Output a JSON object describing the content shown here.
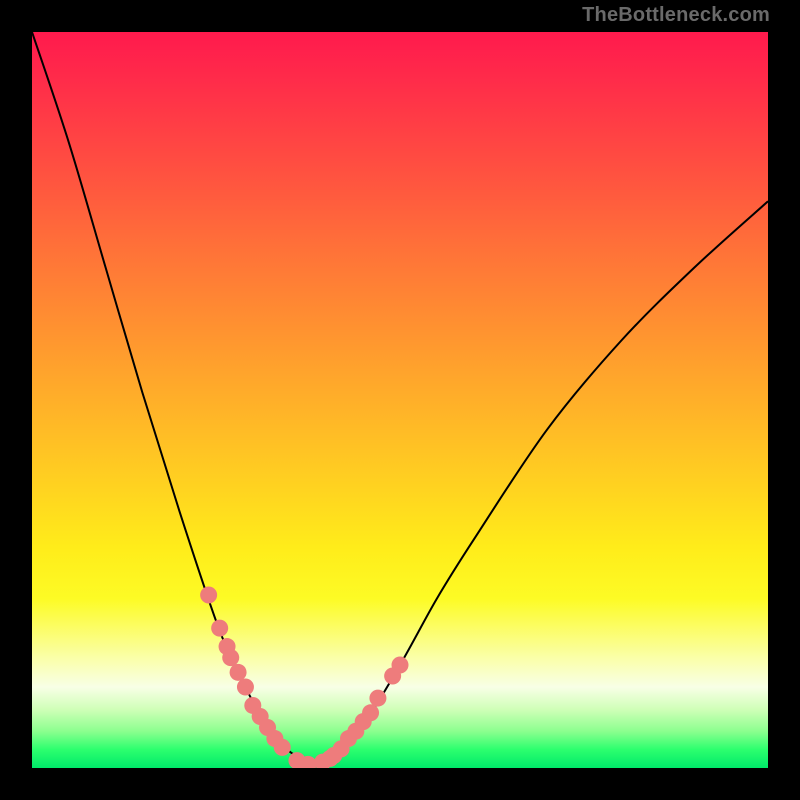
{
  "watermark": "TheBottleneck.com",
  "colors": {
    "frame": "#000000",
    "curve": "#000000",
    "dot_fill": "#ee7c7c",
    "dot_stroke": "#d86a6a"
  },
  "chart_data": {
    "type": "line",
    "title": "",
    "xlabel": "",
    "ylabel": "",
    "xlim": [
      0,
      100
    ],
    "ylim": [
      0,
      100
    ],
    "x": [
      0,
      5,
      10,
      15,
      20,
      25,
      27.5,
      30,
      32,
      34,
      36,
      37,
      38,
      40,
      45,
      50,
      55,
      60,
      70,
      80,
      90,
      100
    ],
    "values": [
      100,
      85,
      68,
      51,
      35,
      20,
      14,
      9,
      5,
      3,
      1.5,
      0.5,
      0.5,
      1,
      6,
      14,
      23,
      31,
      46,
      58,
      68,
      77
    ],
    "annotations_x": [
      24,
      25.5,
      26.5,
      27,
      28,
      29,
      30,
      31,
      32,
      33,
      34,
      36,
      37.5,
      39.5,
      40.5,
      41,
      42,
      43,
      44,
      45,
      46,
      47,
      49,
      50
    ],
    "annotations_y": [
      23.5,
      19,
      16.5,
      15,
      13,
      11,
      8.5,
      7,
      5.5,
      4,
      2.8,
      1,
      0.5,
      0.8,
      1.3,
      1.7,
      2.6,
      4,
      5,
      6.3,
      7.5,
      9.5,
      12.5,
      14
    ],
    "note": "V-shaped bottleneck curve; minimum (0% bottleneck) near x≈37. Pink dots mark sampled configurations clustered around the trough."
  }
}
